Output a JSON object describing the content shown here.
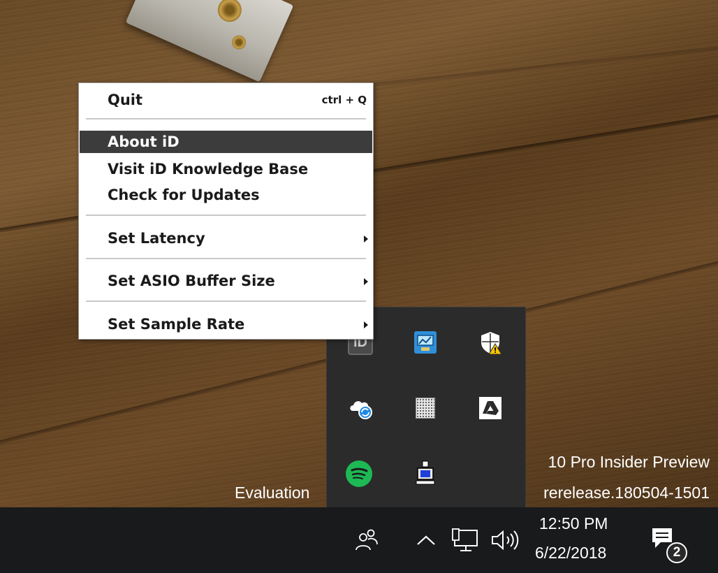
{
  "context_menu": {
    "items": [
      {
        "label": "Quit",
        "shortcut": "ctrl + Q"
      },
      {
        "label": "About iD",
        "highlighted": true
      },
      {
        "label": "Visit iD Knowledge Base"
      },
      {
        "label": "Check for Updates"
      },
      {
        "label": "Set Latency",
        "has_submenu": true
      },
      {
        "label": "Set ASIO Buffer Size",
        "has_submenu": true
      },
      {
        "label": "Set Sample Rate",
        "has_submenu": true
      }
    ]
  },
  "tray_overflow": {
    "icons": [
      {
        "icon": "id-audio-icon",
        "label": "iD"
      },
      {
        "icon": "network-monitor-icon"
      },
      {
        "icon": "windows-security-warning-icon"
      },
      {
        "icon": "onedrive-sync-icon"
      },
      {
        "icon": "grid-app-icon"
      },
      {
        "icon": "google-drive-icon"
      },
      {
        "icon": "spotify-icon"
      },
      {
        "icon": "remote-access-icon"
      }
    ]
  },
  "watermark": {
    "line1": "10 Pro Insider Preview",
    "line2_left": "Evaluation",
    "line2_right": "rerelease.180504-1501"
  },
  "taskbar": {
    "icons": [
      "people-icon",
      "show-hidden-icons-chevron",
      "network-icon",
      "volume-icon",
      "action-center-icon"
    ],
    "time": "12:50 PM",
    "date": "6/22/2018",
    "notification_count": "2"
  },
  "colors": {
    "menu_highlight": "#3c3c3c",
    "taskbar": "#191a1c",
    "tray_panel": "#2b2b2b",
    "spotify_green": "#1db954",
    "warning_yellow": "#f5c400"
  }
}
